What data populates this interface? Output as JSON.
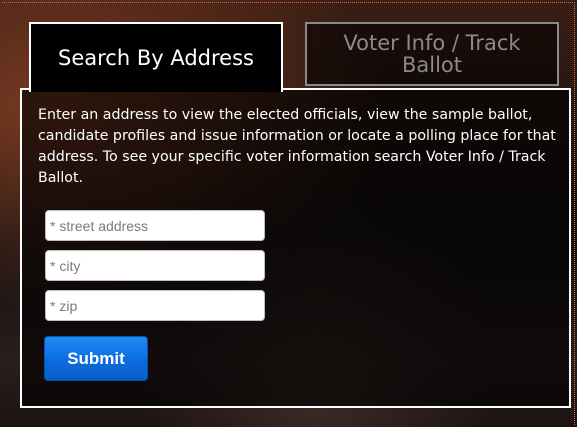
{
  "tabs": {
    "search_by_address": "Search By Address",
    "voter_info": "Voter Info / Track Ballot"
  },
  "description": "Enter an address to view the elected officials, view the sample ballot, candidate profiles and issue information or locate a polling place for that address. To see your specific voter information search Voter Info / Track Ballot.",
  "form": {
    "street_placeholder": "* street address",
    "city_placeholder": "* city",
    "zip_placeholder": "* zip",
    "submit_label": "Submit"
  },
  "colors": {
    "accent": "#0d6ee0",
    "panel_border": "#ffffff",
    "inactive_tab": "#8a8a8a"
  }
}
